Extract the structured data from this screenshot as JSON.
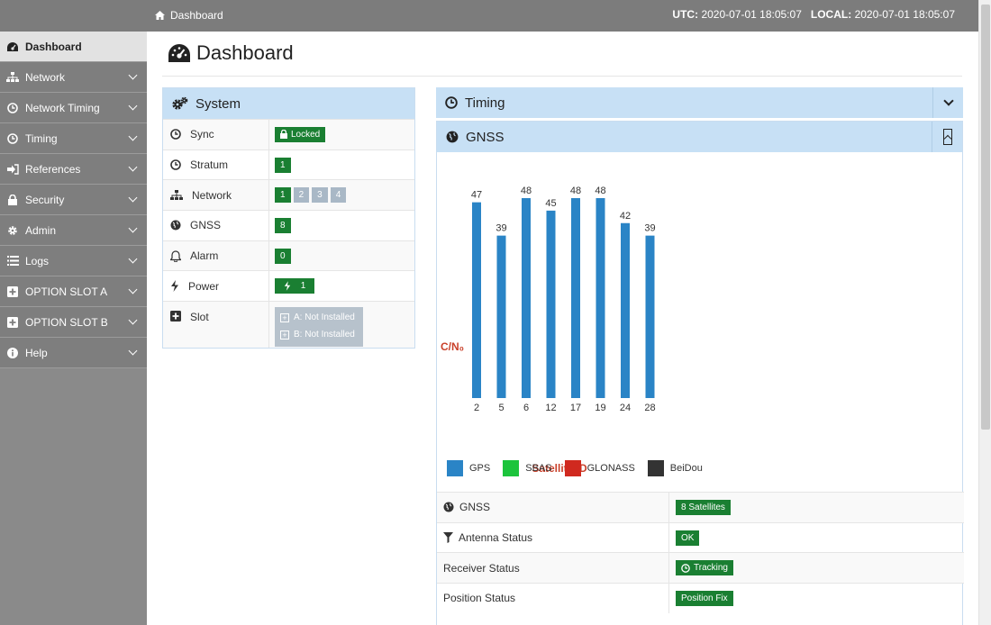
{
  "topbar": {
    "breadcrumb": "Dashboard",
    "utc_label": "UTC:",
    "utc_value": "2020-07-01 18:05:07",
    "local_label": "LOCAL:",
    "local_value": "2020-07-01 18:05:07"
  },
  "sidebar": {
    "items": [
      {
        "label": "Dashboard",
        "icon": "dashboard-icon"
      },
      {
        "label": "Network",
        "icon": "network-icon"
      },
      {
        "label": "Network Timing",
        "icon": "clock-icon"
      },
      {
        "label": "Timing",
        "icon": "clock-icon"
      },
      {
        "label": "References",
        "icon": "sign-in-icon"
      },
      {
        "label": "Security",
        "icon": "lock-icon"
      },
      {
        "label": "Admin",
        "icon": "gear-icon"
      },
      {
        "label": "Logs",
        "icon": "list-icon"
      },
      {
        "label": "OPTION SLOT A",
        "icon": "plus-square-icon"
      },
      {
        "label": "OPTION SLOT B",
        "icon": "plus-square-icon"
      },
      {
        "label": "Help",
        "icon": "info-icon"
      }
    ]
  },
  "page": {
    "title": "Dashboard"
  },
  "system": {
    "title": "System",
    "rows": {
      "sync": {
        "label": "Sync",
        "value": "Locked"
      },
      "stratum": {
        "label": "Stratum",
        "value": "1"
      },
      "network": {
        "label": "Network",
        "ports": [
          "1",
          "2",
          "3",
          "4"
        ]
      },
      "gnss": {
        "label": "GNSS",
        "value": "8"
      },
      "alarm": {
        "label": "Alarm",
        "value": "0"
      },
      "power": {
        "label": "Power",
        "value": "1"
      },
      "slot": {
        "label": "Slot",
        "a": "A: Not Installed",
        "b": "B: Not Installed"
      }
    }
  },
  "timing": {
    "title": "Timing"
  },
  "gnss": {
    "title": "GNSS",
    "legend": [
      {
        "label": "GPS",
        "color": "#2a84c6"
      },
      {
        "label": "SBAS",
        "color": "#1cc43c"
      },
      {
        "label": "GLONASS",
        "color": "#d0291f"
      },
      {
        "label": "BeiDou",
        "color": "#333333"
      }
    ],
    "table": {
      "gnss": {
        "label": "GNSS",
        "value": "8 Satellites"
      },
      "antenna": {
        "label": "Antenna Status",
        "value": "OK"
      },
      "receiver": {
        "label": "Receiver Status",
        "value": "Tracking"
      },
      "position": {
        "label": "Position Status",
        "value": "Position Fix"
      }
    }
  },
  "chart_data": {
    "type": "bar",
    "xlabel": "Satellite ID",
    "ylabel": "C/N₀",
    "categories": [
      "2",
      "5",
      "6",
      "12",
      "17",
      "19",
      "24",
      "28"
    ],
    "series": [
      {
        "name": "GPS",
        "values": [
          47,
          39,
          48,
          45,
          48,
          48,
          42,
          39
        ],
        "color": "#2a84c6"
      }
    ],
    "ylim": [
      0,
      50
    ],
    "data_labels": true
  }
}
